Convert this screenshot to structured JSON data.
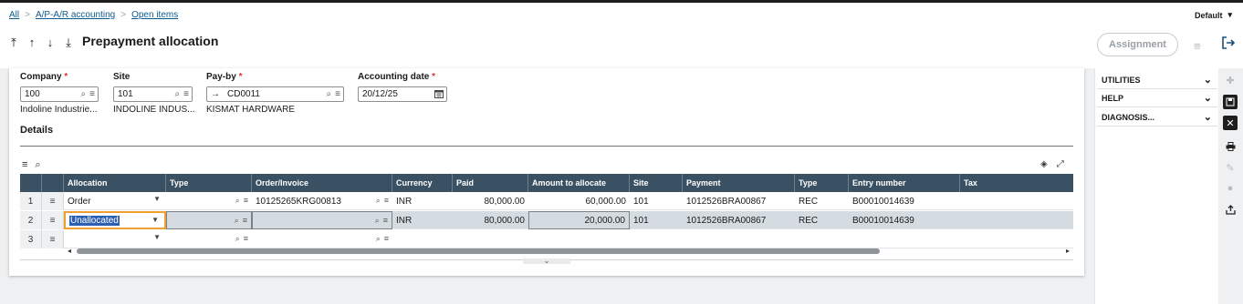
{
  "breadcrumb": {
    "root": "All",
    "module": "A/P-A/R accounting",
    "current": "Open items"
  },
  "header": {
    "title": "Prepayment allocation",
    "preset": "Default",
    "assignment_label": "Assignment"
  },
  "form": {
    "company": {
      "label": "Company",
      "value": "100",
      "description": "Indoline Industrie..."
    },
    "site": {
      "label": "Site",
      "value": "101",
      "description": "INDOLINE INDUS..."
    },
    "payby": {
      "label": "Pay-by",
      "value": "CD0011",
      "description": "KISMAT HARDWARE"
    },
    "acctdate": {
      "label": "Accounting date",
      "value": "20/12/25"
    }
  },
  "details": {
    "title": "Details",
    "columns": [
      "Allocation",
      "Type",
      "Order/Invoice",
      "Currency",
      "Paid",
      "Amount to allocate",
      "Site",
      "Payment",
      "Type",
      "Entry number",
      "Tax"
    ],
    "rows": [
      {
        "num": "1",
        "allocation": "Order",
        "type": "",
        "order": "10125265KRG00813",
        "currency": "INR",
        "paid": "80,000.00",
        "amount": "60,000.00",
        "site": "101",
        "payment": "1012526BRA00867",
        "ptype": "REC",
        "entry": "B00010014639",
        "tax": ""
      },
      {
        "num": "2",
        "allocation": "Unallocated",
        "type": "",
        "order": "",
        "currency": "INR",
        "paid": "80,000.00",
        "amount": "20,000.00",
        "site": "101",
        "payment": "1012526BRA00867",
        "ptype": "REC",
        "entry": "B00010014639",
        "tax": ""
      },
      {
        "num": "3",
        "allocation": "",
        "type": "",
        "order": "",
        "currency": "",
        "paid": "",
        "amount": "",
        "site": "",
        "payment": "",
        "ptype": "",
        "entry": "",
        "tax": ""
      }
    ]
  },
  "side_panel": {
    "items": [
      "UTILITIES",
      "HELP",
      "DIAGNOSIS..."
    ]
  },
  "icons": {
    "nav": [
      "first-icon",
      "previous-icon",
      "next-icon",
      "last-icon"
    ],
    "rail": [
      "add-icon",
      "save-icon",
      "close-icon",
      "print-icon",
      "attachment-icon",
      "comment-icon",
      "export-icon"
    ]
  },
  "colors": {
    "grid_header": "#3a5163",
    "focus": "#f0a030",
    "required": "#dd3333",
    "selection": "#2b5fb3"
  }
}
